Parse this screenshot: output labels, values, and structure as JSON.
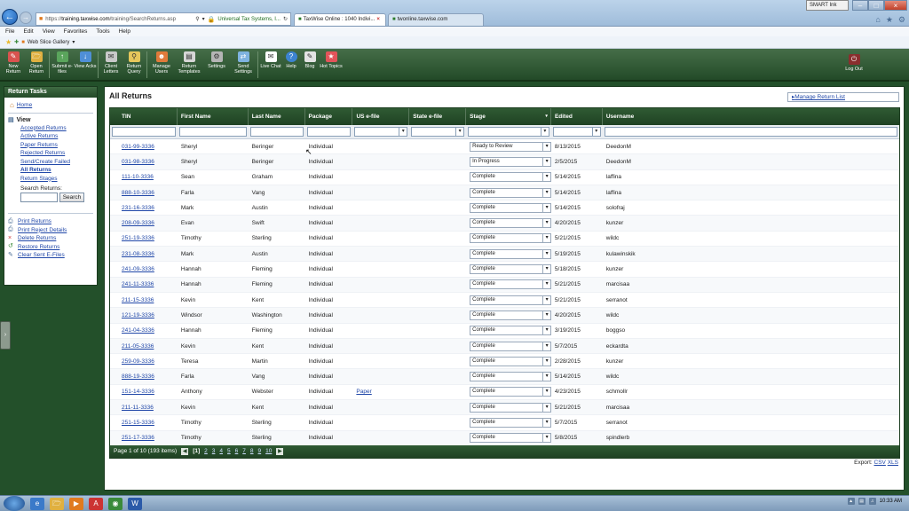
{
  "browser": {
    "address": {
      "prefix": "https://",
      "host": "training.taxwise.com",
      "path": "/training/SearchReturns.asp",
      "site": "Universal Tax Systems, I..."
    },
    "tabs": [
      {
        "label": "TaxWise Online : 1040 Indivi..."
      },
      {
        "label": "twonline.taxwise.com"
      }
    ],
    "smart_ink": "SMART Ink",
    "menu": [
      "File",
      "Edit",
      "View",
      "Favorites",
      "Tools",
      "Help"
    ],
    "favorites": {
      "label": "Web Slice Gallery"
    }
  },
  "toolbar": {
    "buttons": [
      {
        "label": "New Return",
        "color": "#d9534f",
        "icon": "new-return-icon"
      },
      {
        "label": "Open Return",
        "color": "#e0b040",
        "icon": "open-return-icon"
      },
      {
        "label": "Submit e-files",
        "color": "#5aa55c",
        "icon": "submit-efiles-icon"
      },
      {
        "label": "View Acks",
        "color": "#4f8fd6",
        "icon": "view-acks-icon"
      },
      {
        "label": "Client Letters",
        "color": "#c9c9c9",
        "icon": "client-letters-icon"
      },
      {
        "label": "Return Query",
        "color": "#e6c75b",
        "icon": "return-query-icon"
      },
      {
        "label": "Manage Users",
        "color": "#e07a3a",
        "icon": "manage-users-icon"
      },
      {
        "label": "Return Templates",
        "color": "#d6d6d6",
        "icon": "return-templates-icon"
      },
      {
        "label": "Settings",
        "color": "#b5b5b5",
        "icon": "settings-icon"
      },
      {
        "label": "Send Settings",
        "color": "#7fb3e0",
        "icon": "send-settings-icon"
      },
      {
        "label": "Live Chat",
        "color": "#ffffff",
        "icon": "live-chat-icon"
      },
      {
        "label": "Help",
        "color": "#3c83d1",
        "icon": "help-icon"
      },
      {
        "label": "Blog",
        "color": "#e3e3e3",
        "icon": "blog-icon"
      },
      {
        "label": "Hot Topics",
        "color": "#e2545a",
        "icon": "hot-topics-icon"
      }
    ],
    "logout": "Log Out"
  },
  "sidebar": {
    "title": "Return Tasks",
    "home": "Home",
    "view_label": "View",
    "view_items": [
      "Accepted Returns",
      "Active Returns",
      "Paper Returns",
      "Rejected Returns",
      "Send/Create Failed",
      "All Returns",
      "Return Stages"
    ],
    "search_label": "Search Returns:",
    "search_button": "Search",
    "actions": [
      "Print Returns",
      "Print Reject Details",
      "Delete Returns",
      "Restore Returns",
      "Clear Sent E-Files"
    ]
  },
  "main": {
    "title": "All Returns",
    "manage_link": "Manage Return List",
    "columns": [
      "TIN",
      "First Name",
      "Last Name",
      "Package",
      "US e-file",
      "State e-file",
      "Stage",
      "Edited",
      "Username"
    ],
    "rows": [
      {
        "tin": "031-99-3336",
        "first": "Sheryl",
        "last": "Beringer",
        "package": "Individual",
        "us": "",
        "state": "",
        "stage": "Ready to Review",
        "edited": "8/13/2015",
        "user": "DeedonM"
      },
      {
        "tin": "031-98-3336",
        "first": "Sheryl",
        "last": "Beringer",
        "package": "Individual",
        "us": "",
        "state": "",
        "stage": "In Progress",
        "edited": "2/5/2015",
        "user": "DeedonM"
      },
      {
        "tin": "111-10-3336",
        "first": "Sean",
        "last": "Graham",
        "package": "Individual",
        "us": "",
        "state": "",
        "stage": "Complete",
        "edited": "5/14/2015",
        "user": "laffina"
      },
      {
        "tin": "888-10-3336",
        "first": "Farla",
        "last": "Vang",
        "package": "Individual",
        "us": "",
        "state": "",
        "stage": "Complete",
        "edited": "5/14/2015",
        "user": "laffina"
      },
      {
        "tin": "231-16-3336",
        "first": "Mark",
        "last": "Austin",
        "package": "Individual",
        "us": "",
        "state": "",
        "stage": "Complete",
        "edited": "5/14/2015",
        "user": "solofraj"
      },
      {
        "tin": "208-09-3336",
        "first": "Evan",
        "last": "Swift",
        "package": "Individual",
        "us": "",
        "state": "",
        "stage": "Complete",
        "edited": "4/20/2015",
        "user": "kunzer"
      },
      {
        "tin": "251-19-3336",
        "first": "Timothy",
        "last": "Sterling",
        "package": "Individual",
        "us": "",
        "state": "",
        "stage": "Complete",
        "edited": "5/21/2015",
        "user": "wildc"
      },
      {
        "tin": "231-08-3336",
        "first": "Mark",
        "last": "Austin",
        "package": "Individual",
        "us": "",
        "state": "",
        "stage": "Complete",
        "edited": "5/19/2015",
        "user": "kulawinskik"
      },
      {
        "tin": "241-09-3336",
        "first": "Hannah",
        "last": "Fleming",
        "package": "Individual",
        "us": "",
        "state": "",
        "stage": "Complete",
        "edited": "5/18/2015",
        "user": "kunzer"
      },
      {
        "tin": "241-11-3336",
        "first": "Hannah",
        "last": "Fleming",
        "package": "Individual",
        "us": "",
        "state": "",
        "stage": "Complete",
        "edited": "5/21/2015",
        "user": "marcisaa"
      },
      {
        "tin": "211-15-3336",
        "first": "Kevin",
        "last": "Kent",
        "package": "Individual",
        "us": "",
        "state": "",
        "stage": "Complete",
        "edited": "5/21/2015",
        "user": "serranot"
      },
      {
        "tin": "121-19-3336",
        "first": "Windsor",
        "last": "Washington",
        "package": "Individual",
        "us": "",
        "state": "",
        "stage": "Complete",
        "edited": "4/20/2015",
        "user": "wildc"
      },
      {
        "tin": "241-04-3336",
        "first": "Hannah",
        "last": "Fleming",
        "package": "Individual",
        "us": "",
        "state": "",
        "stage": "Complete",
        "edited": "3/19/2015",
        "user": "boggso"
      },
      {
        "tin": "211-05-3336",
        "first": "Kevin",
        "last": "Kent",
        "package": "Individual",
        "us": "",
        "state": "",
        "stage": "Complete",
        "edited": "5/7/2015",
        "user": "eckardta"
      },
      {
        "tin": "259-09-3336",
        "first": "Teresa",
        "last": "Martin",
        "package": "Individual",
        "us": "",
        "state": "",
        "stage": "Complete",
        "edited": "2/28/2015",
        "user": "kunzer"
      },
      {
        "tin": "888-19-3336",
        "first": "Farla",
        "last": "Vang",
        "package": "Individual",
        "us": "",
        "state": "",
        "stage": "Complete",
        "edited": "5/14/2015",
        "user": "wildc"
      },
      {
        "tin": "151-14-3336",
        "first": "Anthony",
        "last": "Webster",
        "package": "Individual",
        "us": "Paper",
        "state": "",
        "stage": "Complete",
        "edited": "4/23/2015",
        "user": "schmollr"
      },
      {
        "tin": "211-11-3336",
        "first": "Kevin",
        "last": "Kent",
        "package": "Individual",
        "us": "",
        "state": "",
        "stage": "Complete",
        "edited": "5/21/2015",
        "user": "marcisaa"
      },
      {
        "tin": "251-15-3336",
        "first": "Timothy",
        "last": "Sterling",
        "package": "Individual",
        "us": "",
        "state": "",
        "stage": "Complete",
        "edited": "5/7/2015",
        "user": "serranot"
      },
      {
        "tin": "251-17-3336",
        "first": "Timothy",
        "last": "Sterling",
        "package": "Individual",
        "us": "",
        "state": "",
        "stage": "Complete",
        "edited": "5/8/2015",
        "user": "spindlerb"
      }
    ],
    "pager": {
      "summary": "Page 1 of 10 (193 items)",
      "current": "[1]",
      "pages": [
        "2",
        "3",
        "4",
        "5",
        "6",
        "7",
        "8",
        "9",
        "10"
      ]
    },
    "export": {
      "label": "Export:",
      "csv": "CSV",
      "xls": "XLS"
    }
  },
  "taskbar": {
    "clock": "10:33 AM"
  }
}
